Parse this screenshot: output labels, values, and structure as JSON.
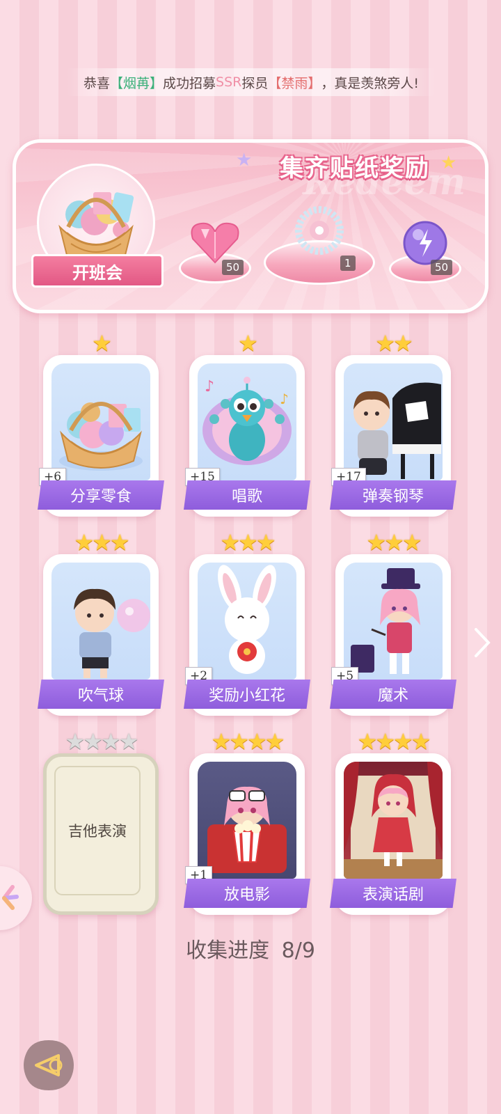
{
  "marquee": {
    "part1": "恭喜",
    "name1": "【烟苒】",
    "part2": "成功招募",
    "rank": "SSR",
    "part3": "探员",
    "name2": "【禁雨】",
    "part4": "，真是羡煞旁人!"
  },
  "banner": {
    "title": "集齐贴纸奖励",
    "watermark": "Redeem",
    "event_label": "开班会",
    "rewards": [
      {
        "name": "heart-gem-icon",
        "qty": "50"
      },
      {
        "name": "pearl-bracelet-icon",
        "qty": "1"
      },
      {
        "name": "purple-orb-icon",
        "qty": "50"
      }
    ]
  },
  "cards": [
    {
      "label": "分享零食",
      "plus": "+6",
      "stars": "★"
    },
    {
      "label": "唱歌",
      "plus": "+15",
      "stars": "★"
    },
    {
      "label": "弹奏钢琴",
      "plus": "+17",
      "stars": "★★"
    },
    {
      "label": "吹气球",
      "plus": "",
      "stars": "★★★"
    },
    {
      "label": "奖励小红花",
      "plus": "+2",
      "stars": "★★★"
    },
    {
      "label": "魔术",
      "plus": "+5",
      "stars": "★★★"
    },
    {
      "label": "吉他表演",
      "plus": "",
      "stars": "★★★★",
      "locked": true
    },
    {
      "label": "放电影",
      "plus": "+1",
      "stars": "★★★★"
    },
    {
      "label": "表演话剧",
      "plus": "",
      "stars": "★★★★"
    }
  ],
  "progress": {
    "label": "收集进度",
    "value": "8/9"
  }
}
